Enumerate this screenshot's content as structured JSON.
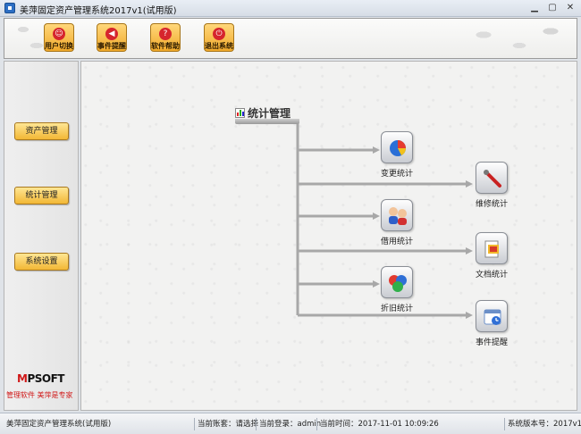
{
  "window": {
    "title": "美萍固定资产管理系统2017v1(试用版)"
  },
  "toolbar": {
    "buttons": [
      {
        "label": "用户切换",
        "icon": "user-switch-icon"
      },
      {
        "label": "事件提醒",
        "icon": "reminder-icon"
      },
      {
        "label": "软件帮助",
        "icon": "help-icon"
      },
      {
        "label": "退出系统",
        "icon": "power-icon"
      }
    ]
  },
  "sidebar": {
    "items": [
      {
        "label": "资产管理"
      },
      {
        "label": "统计管理"
      },
      {
        "label": "系统设置"
      }
    ],
    "logo_text": "MPSOFT",
    "slogan": "管理软件  美萍是专家"
  },
  "main": {
    "section_title": "统计管理",
    "nodes": [
      {
        "label": "变更统计",
        "icon": "pie-chart-icon"
      },
      {
        "label": "维修统计",
        "icon": "repair-tool-icon"
      },
      {
        "label": "借用统计",
        "icon": "borrow-users-icon"
      },
      {
        "label": "文档统计",
        "icon": "document-icon"
      },
      {
        "label": "折旧统计",
        "icon": "depreciation-icon"
      },
      {
        "label": "事件提醒",
        "icon": "event-clock-icon"
      }
    ]
  },
  "status": {
    "app": "美萍固定资产管理系统(试用版)",
    "account_set": "当前账套：请选择",
    "login": "当前登录：admin",
    "time": "当前时间：2017-11-01 10:09:26",
    "version": "系统版本号：2017v1"
  }
}
